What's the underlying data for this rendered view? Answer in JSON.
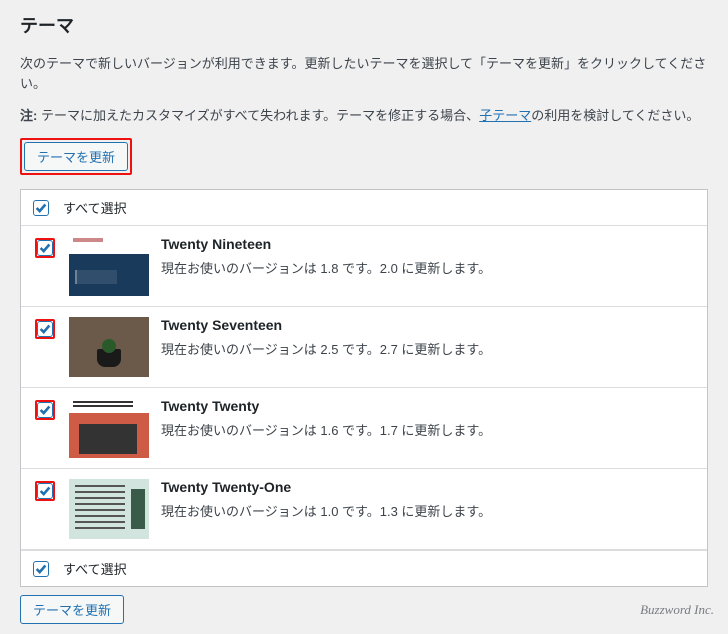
{
  "title": "テーマ",
  "description": "次のテーマで新しいバージョンが利用できます。更新したいテーマを選択して「テーマを更新」をクリックしてください。",
  "note_prefix": "注:",
  "note_body_1": " テーマに加えたカスタマイズがすべて失われます。テーマを修正する場合、",
  "note_link": "子テーマ",
  "note_body_2": "の利用を検討してください。",
  "update_button": "テーマを更新",
  "select_all": "すべて選択",
  "themes": [
    {
      "name": "Twenty Nineteen",
      "version_text": "現在お使いのバージョンは 1.8 です。2.0 に更新します。",
      "thumb_class": "th-nineteen"
    },
    {
      "name": "Twenty Seventeen",
      "version_text": "現在お使いのバージョンは 2.5 です。2.7 に更新します。",
      "thumb_class": "th-seventeen"
    },
    {
      "name": "Twenty Twenty",
      "version_text": "現在お使いのバージョンは 1.6 です。1.7 に更新します。",
      "thumb_class": "th-twenty"
    },
    {
      "name": "Twenty Twenty-One",
      "version_text": "現在お使いのバージョンは 1.0 です。1.3 に更新します。",
      "thumb_class": "th-twentyone"
    }
  ],
  "footer": "Buzzword Inc."
}
